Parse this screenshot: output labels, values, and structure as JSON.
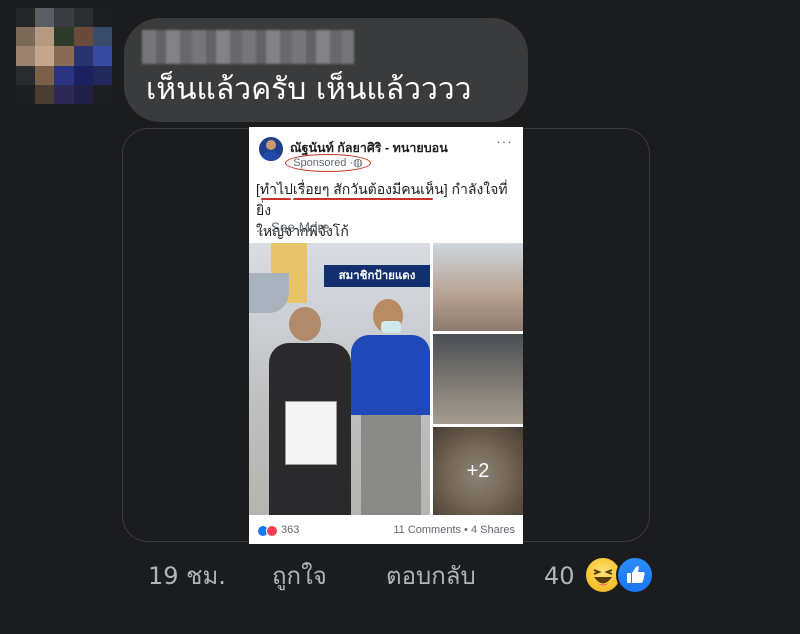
{
  "comment": {
    "author_name": "",
    "text": "เห็นแล้วครับ เห็นแล้วววว"
  },
  "shared_post": {
    "page_name": "ณัฐนันท์ กัลยาศิริ - ทนายบอน",
    "sponsored_label": "Sponsored",
    "more_menu": "···",
    "text_line1": "[ทำไปเรื่อยๆ สักวันต้องมีคนเห็น] กำลังใจที่ยิ่ง",
    "text_line2": "ใหญ่จากพี่จังโก้",
    "see_more": "... See More",
    "banner_text": "สมาชิกป้ายแดง",
    "extra_photos": "+2",
    "reaction_count": "363",
    "comments_shares": "11 Comments • 4 Shares"
  },
  "actions": {
    "time": "19 ชม.",
    "like": "ถูกใจ",
    "reply": "ตอบกลับ",
    "reaction_count": "40"
  },
  "reaction_icons": [
    "haha-emoji-icon",
    "like-emoji-icon"
  ],
  "colors": {
    "background": "#1b1c1e",
    "bubble": "#3a3b3c",
    "secondary_text": "#b0b3b8",
    "like_blue": "#1877f2",
    "annotation_red": "#c8332b"
  }
}
